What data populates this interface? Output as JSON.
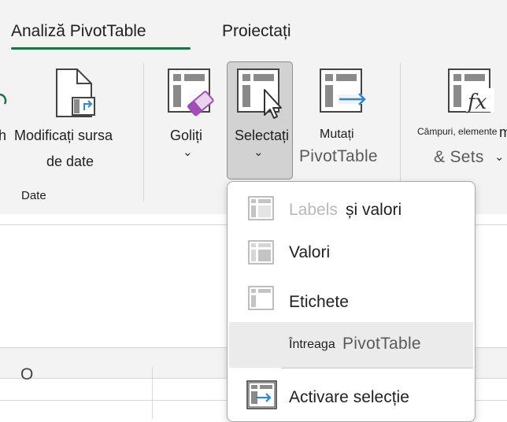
{
  "tabs": {
    "analyze": "Analiză PivotTable",
    "design": "Proiectați"
  },
  "ribbon": {
    "cut_left": "h",
    "change_source_line1": "Modificați sursa",
    "change_source_line2": "de date",
    "group_data": "Date",
    "clear": "Goliți",
    "select": "Selectați",
    "move": "Mutați",
    "move_overlay": "PivotTable",
    "fields_items": "Câmpuri, elemente",
    "sets_overlay": "& Sets",
    "cut_right": "m",
    "chevron": "⌄"
  },
  "menu": {
    "item1_ghost": "Labels",
    "item1_text": "și valori",
    "item2_text": "Valori",
    "item3_text": "Etichete",
    "item4_text": "Întreaga",
    "item4_overlay": "PivotTable",
    "item5_text": "Activare selecție"
  },
  "grid": {
    "column_label": "O"
  },
  "colors": {
    "accent_green": "#1e7145",
    "eraser_purple": "#a04db8",
    "arrow_blue": "#2b88d8"
  }
}
